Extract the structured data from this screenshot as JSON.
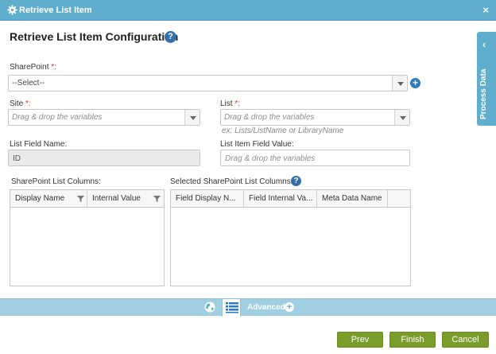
{
  "window": {
    "title": "Retrieve List Item",
    "close_glyph": "×"
  },
  "page": {
    "heading": "Retrieve List Item Configuration",
    "help_glyph": "?"
  },
  "sharepoint": {
    "label": "SharePoint",
    "required_mark": "*:",
    "value": "--Select--",
    "add_glyph": "+"
  },
  "site": {
    "label": "Site",
    "required_mark": "*:",
    "placeholder": "Drag & drop the variables"
  },
  "list": {
    "label": "List",
    "required_mark": "*:",
    "placeholder": "Drag & drop the variables",
    "hint": "ex: Lists/ListName or LibraryName"
  },
  "list_field_name": {
    "label": "List Field Name:",
    "value": "ID"
  },
  "list_item_field_value": {
    "label": "List Item Field Value:",
    "placeholder": "Drag & drop the variables"
  },
  "sp_columns": {
    "label": "SharePoint List Columns:",
    "columns": [
      "Display Name",
      "Internal Value"
    ]
  },
  "selected_columns": {
    "label": "Selected SharePoint List Columns:",
    "columns": [
      "Field Display N...",
      "Field Internal Va...",
      "Meta Data Name"
    ]
  },
  "side_panel": {
    "chevron": "‹",
    "label": "Process Data"
  },
  "bottom_bar": {
    "advanced_label": "Advanced",
    "plus_glyph": "+"
  },
  "buttons": {
    "prev": "Prev",
    "finish": "Finish",
    "cancel": "Cancel"
  },
  "colors": {
    "header": "#5faecd",
    "bottom_bar": "#9fcfe0",
    "button": "#7a9c2b",
    "help": "#3471a8",
    "required": "#d32f2f"
  }
}
